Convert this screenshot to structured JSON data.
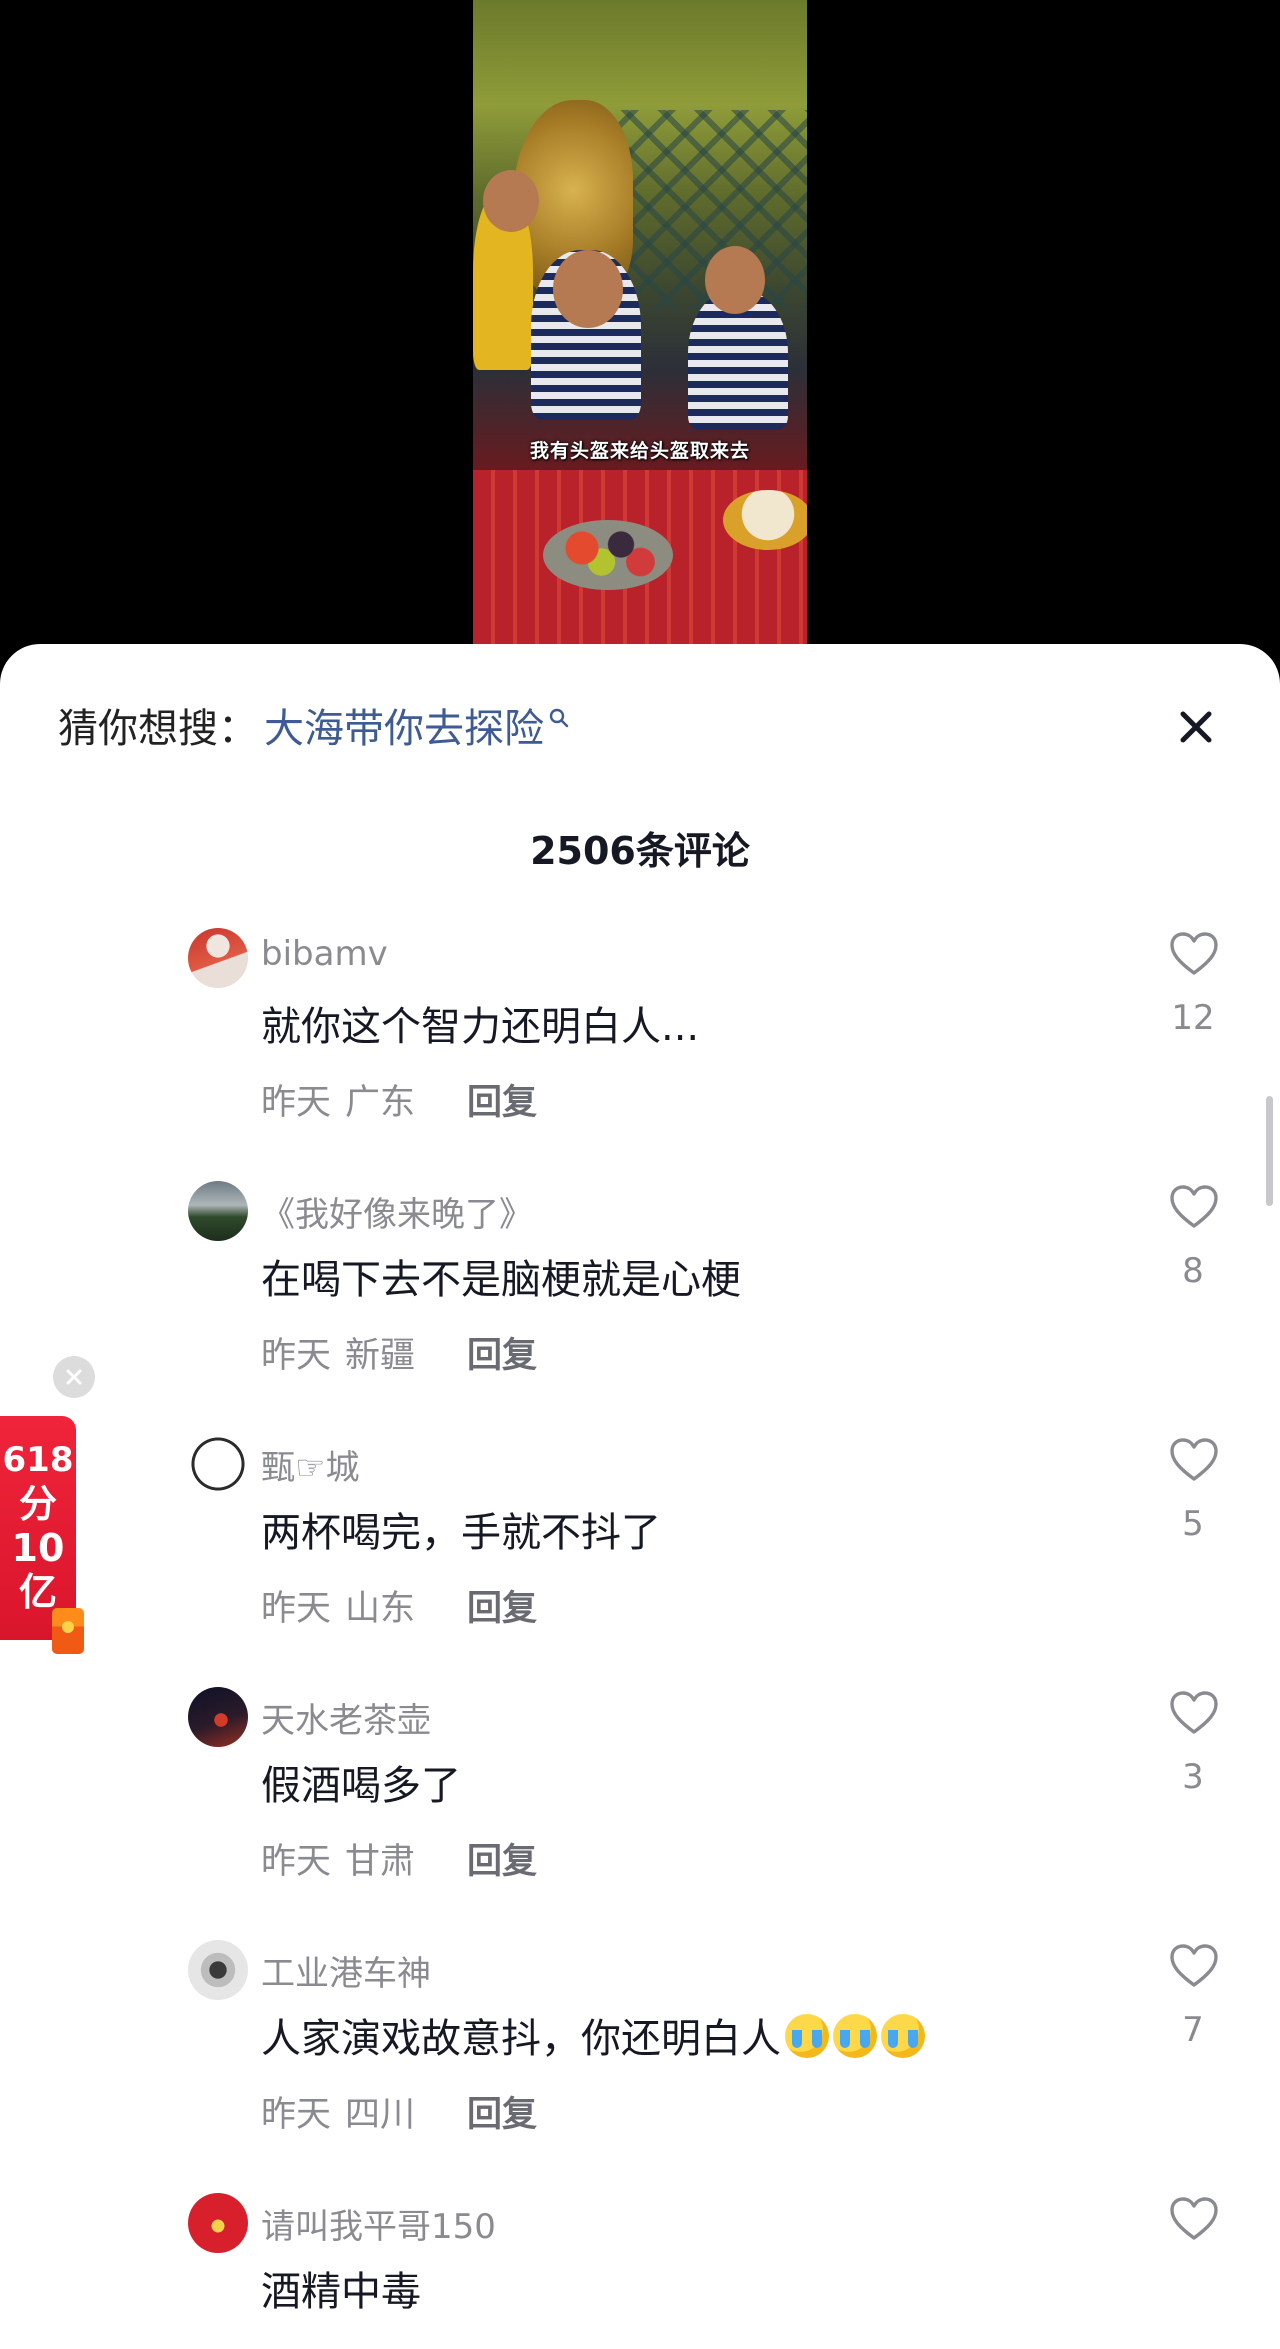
{
  "video": {
    "caption": "我有头盔来给头盔取来去"
  },
  "search_suggestion": {
    "label": "猜你想搜：",
    "query": "大海带你去探险"
  },
  "comments_header": {
    "title": "2506条评论"
  },
  "comments": [
    {
      "username": "bibamv",
      "text": "就你这个智力还明白人...",
      "time": "昨天",
      "location": "广东",
      "reply": "回复",
      "likes": "12"
    },
    {
      "username": "《我好像来晚了》",
      "text": "在喝下去不是脑梗就是心梗",
      "time": "昨天",
      "location": "新疆",
      "reply": "回复",
      "likes": "8"
    },
    {
      "username": "甄☞城",
      "text": "两杯喝完，手就不抖了",
      "time": "昨天",
      "location": "山东",
      "reply": "回复",
      "likes": "5"
    },
    {
      "username": "天水老茶壶",
      "text": "假酒喝多了",
      "time": "昨天",
      "location": "甘肃",
      "reply": "回复",
      "likes": "3"
    },
    {
      "username": "工业港车神",
      "text": "人家演戏故意抖，你还明白人",
      "emoji_count": 3,
      "time": "昨天",
      "location": "四川",
      "reply": "回复",
      "likes": "7"
    },
    {
      "username": "请叫我平哥150",
      "text": "酒精中毒",
      "likes": ""
    }
  ],
  "promo": {
    "line1": "618",
    "line2": "分",
    "line3": "10",
    "line4": "亿"
  },
  "icons": {
    "close": "close-icon",
    "like": "heart-outline-icon",
    "search": "search-icon",
    "emoji": "crying-face-emoji"
  },
  "colors": {
    "link_blue": "#3e5b94",
    "text_primary": "#161823",
    "text_secondary": "#8a8b91",
    "promo_red": "#e01c32"
  }
}
